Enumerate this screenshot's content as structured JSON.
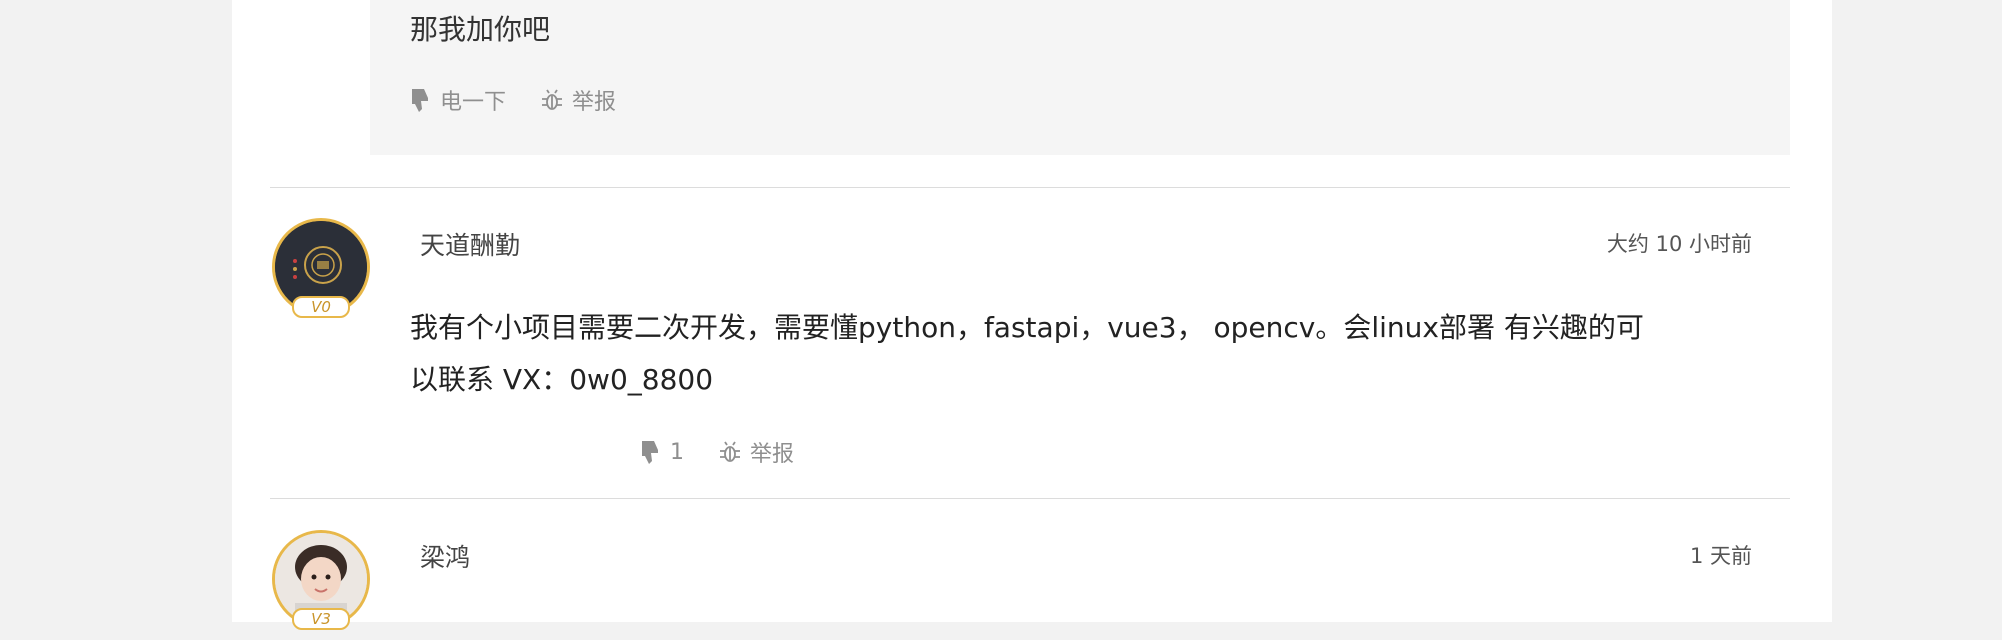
{
  "previous_reply": {
    "text": "那我加你吧",
    "dislike_label": "电一下",
    "report_label": "举报"
  },
  "comments": [
    {
      "username": "天道酬勤",
      "time": "大约 10 小时前",
      "level": "V0",
      "content_line1": "我有个小项目需要二次开发，需要懂python，fastapi，vue3， opencv。会linux部署 有兴趣的可",
      "content_line2": "以联系 VX：0w0_8800",
      "dislike_count": "1",
      "report_label": "举报"
    },
    {
      "username": "梁鸿",
      "time": "1 天前",
      "level": "V3"
    }
  ],
  "colors": {
    "page_bg": "#f2f2f2",
    "card_bg": "#ffffff",
    "reply_bg": "#f5f5f5",
    "avatar_ring": "#e8b84a",
    "muted_text": "#8f8f8f"
  },
  "icons": [
    "thumbs-down-icon",
    "bug-report-icon"
  ]
}
